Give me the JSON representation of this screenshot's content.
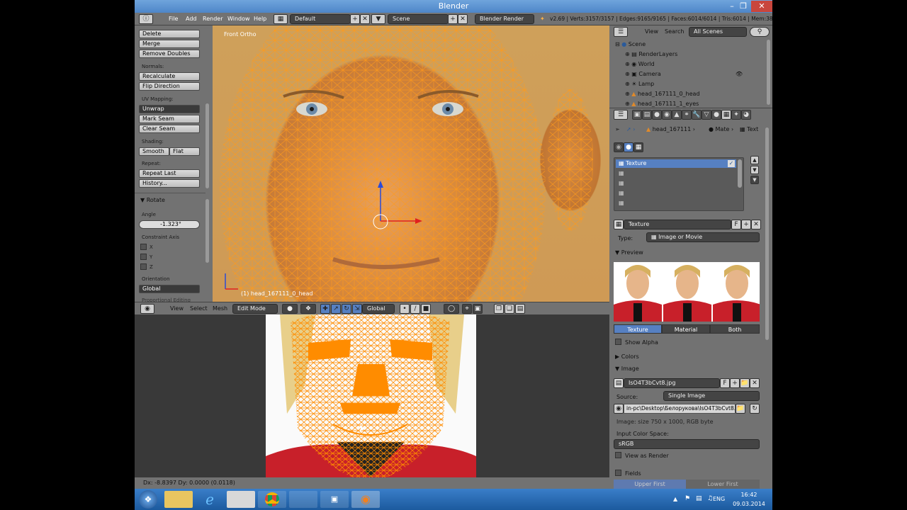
{
  "window": {
    "title": "Blender"
  },
  "menubar": {
    "items": [
      "File",
      "Add",
      "Render",
      "Window",
      "Help"
    ],
    "layout": "Default",
    "scene": "Scene",
    "engine": "Blender Render",
    "stats": "v2.69 | Verts:3157/3157 | Edges:9165/9165 | Faces:6014/6014 | Tris:6014 | Mem:38"
  },
  "toolshelf": {
    "delete": "Delete",
    "merge": "Merge",
    "remove_doubles": "Remove Doubles",
    "normals_label": "Normals:",
    "recalculate": "Recalculate",
    "flip_direction": "Flip Direction",
    "uv_label": "UV Mapping:",
    "unwrap": "Unwrap",
    "mark_seam": "Mark Seam",
    "clear_seam": "Clear Seam",
    "shading_label": "Shading:",
    "smooth": "Smooth",
    "flat": "Flat",
    "repeat_label": "Repeat:",
    "repeat_last": "Repeat Last",
    "history": "History...",
    "rotate_title": "Rotate",
    "angle_label": "Angle",
    "angle_value": "-1.323°",
    "constraint_label": "Constraint Axis",
    "x": "X",
    "y": "Y",
    "z": "Z",
    "orientation_label": "Orientation",
    "orientation_value": "Global",
    "proportional_label": "Proportional Editing"
  },
  "viewport": {
    "view_label": "Front Ortho",
    "object_label": "(1) head_167111_0_head"
  },
  "view3d_header": {
    "view": "View",
    "select": "Select",
    "mesh": "Mesh",
    "mode": "Edit Mode",
    "orientation": "Global"
  },
  "status": {
    "text": "Dx: -8.8397  Dy: 0.0000 (0.0118)"
  },
  "outliner": {
    "view": "View",
    "search": "Search",
    "filter": "All Scenes",
    "rows": [
      "Scene",
      "RenderLayers",
      "World",
      "Camera",
      "Lamp",
      "head_167111_0_head",
      "head_167111_1_eyes"
    ]
  },
  "props": {
    "breadcrumb_obj": "head_167111",
    "breadcrumb_mat": "Mate",
    "breadcrumb_tex": "Text",
    "texture_slot": "Texture",
    "texture_name": "Texture",
    "texture_users": "F",
    "type_label": "Type:",
    "type_value": "Image or Movie",
    "preview_label": "Preview",
    "tab_texture": "Texture",
    "tab_material": "Material",
    "tab_both": "Both",
    "show_alpha": "Show Alpha",
    "colors_label": "Colors",
    "image_label": "Image",
    "image_name": "IsO4T3bCvt8.jpg",
    "image_users": "F",
    "source_label": "Source:",
    "source_value": "Single Image",
    "filepath": "in-pc\\Desktop\\Белорукова\\IsO4T3bCvt8.jpg",
    "image_info": "Image: size 750 x 1000, RGB byte",
    "input_color_label": "Input Color Space:",
    "input_color_value": "sRGB",
    "view_as_render": "View as Render",
    "fields": "Fields",
    "upper_first": "Upper First",
    "lower_first": "Lower First"
  },
  "taskbar": {
    "lang": "ENG",
    "time": "16:42",
    "date": "09.03.2014"
  },
  "colors": {
    "wire": "#ff8c00",
    "active_blue": "#5680c2",
    "panel": "#727272"
  }
}
